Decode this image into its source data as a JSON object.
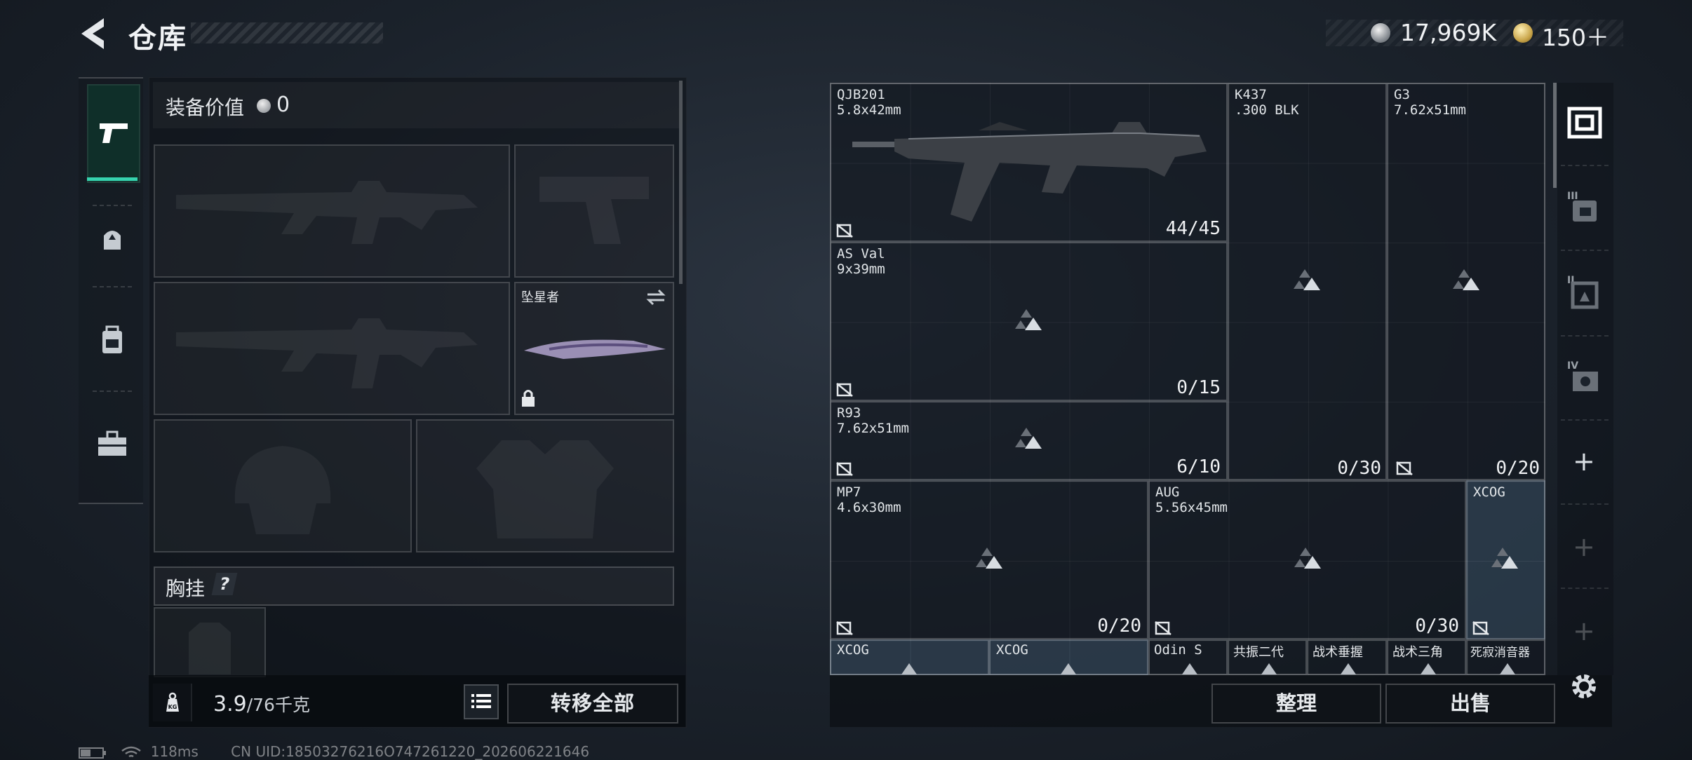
{
  "header": {
    "title": "仓库",
    "currency_silver": "17,969K",
    "currency_gold": "150＋"
  },
  "loadout": {
    "equip_value_label": "装备价值",
    "equip_value": "0",
    "melee_label": "坠星者",
    "vest_title": "胸挂",
    "vest_help": "?",
    "weight": "3.9",
    "weight_max": "/76千克",
    "transfer_all": "转移全部"
  },
  "stash": {
    "items": [
      {
        "name": "QJB201",
        "ammo": "5.8x42mm",
        "count": "44/45"
      },
      {
        "name": "K437",
        "ammo": ".300 BLK",
        "count": ""
      },
      {
        "name": "G3",
        "ammo": "7.62x51mm",
        "count": ""
      },
      {
        "name": "AS Val",
        "ammo": "9x39mm",
        "count": "0/15"
      },
      {
        "name": "R93",
        "ammo": "7.62x51mm",
        "count": "6/10"
      },
      {
        "name": "",
        "ammo": "",
        "count": "0/30"
      },
      {
        "name": "",
        "ammo": "",
        "count": "0/20"
      },
      {
        "name": "MP7",
        "ammo": "4.6x30mm",
        "count": "0/20"
      },
      {
        "name": "AUG",
        "ammo": "5.56x45mm",
        "count": "0/30"
      },
      {
        "name": "XCOG",
        "ammo": "",
        "count": ""
      }
    ],
    "bottom_row": [
      "XCOG",
      "XCOG",
      "Odin S",
      "共振二代",
      "战术垂握",
      "战术三角",
      "死寂消音器"
    ]
  },
  "actions": {
    "organize": "整理",
    "sell": "出售"
  },
  "status": {
    "ping": "118ms",
    "uid": "CN UID:18503276216O747261220_202606221646"
  },
  "colors": {
    "accent": "#36d3ae",
    "highlight_cell": "#4a6f8e"
  },
  "icons": [
    "back-arrow-icon",
    "silver-coin-icon",
    "gold-coin-icon",
    "pistol-icon",
    "helmet-icon",
    "backpack-icon",
    "toolbox-icon",
    "no-ammo-icon",
    "placeholder-triangle-icon",
    "list-icon",
    "weight-icon",
    "lock-icon",
    "swap-icon",
    "settings-icon",
    "plus-icon"
  ]
}
